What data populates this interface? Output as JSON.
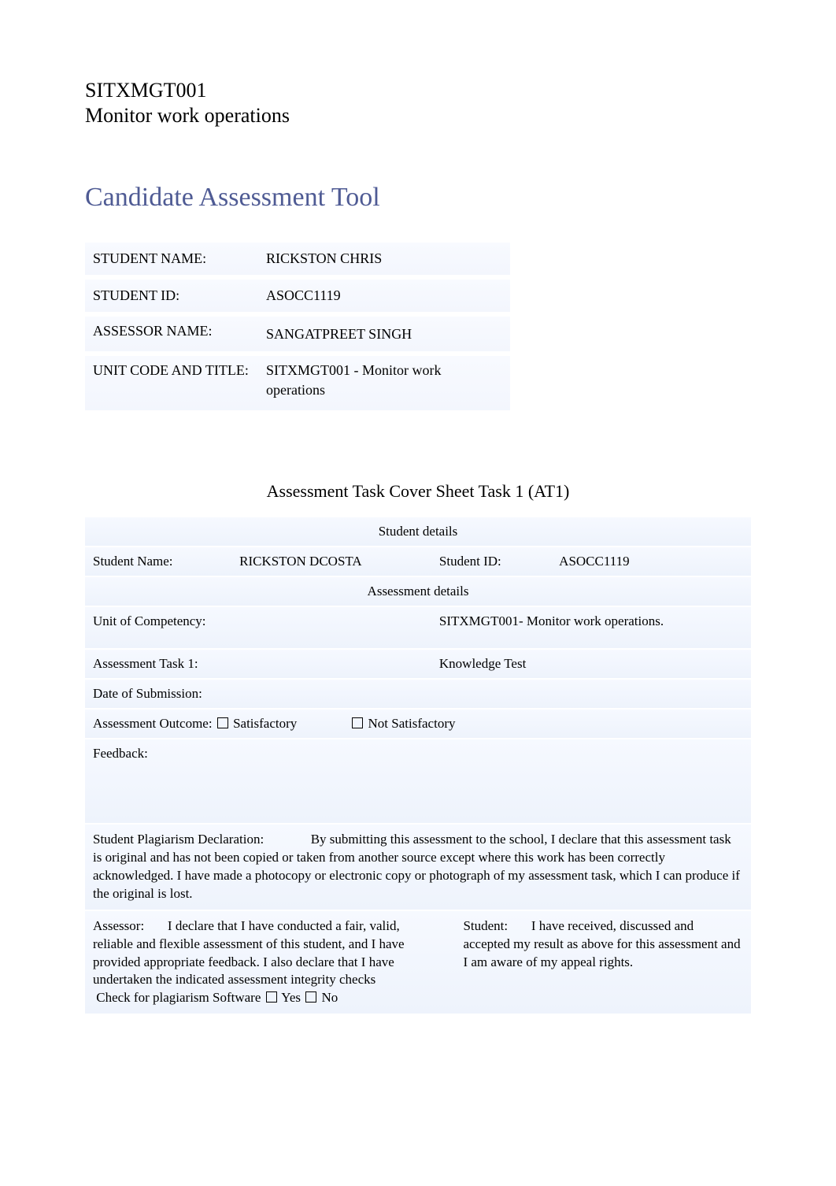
{
  "header": {
    "unit_code": "SITXMGT001",
    "unit_name": "Monitor work operations"
  },
  "main_title": "Candidate Assessment Tool",
  "info_block": {
    "student_name_label": "STUDENT NAME:",
    "student_name_value": "RICKSTON CHRIS",
    "student_id_label": "STUDENT ID:",
    "student_id_value": "ASOCC1119",
    "assessor_name_label": "ASSESSOR NAME:",
    "assessor_name_value": "SANGATPREET SINGH",
    "unit_code_title_label": "UNIT CODE AND TITLE:",
    "unit_code_title_value": " SITXMGT001 - Monitor work operations"
  },
  "cover_sheet": {
    "heading": "Assessment Task Cover Sheet Task 1 (AT1)",
    "student_details_header": "Student details",
    "student_name_label": "Student Name:",
    "student_name_value": "RICKSTON DCOSTA",
    "student_id_label": "Student ID:",
    "student_id_value": "ASOCC1119",
    "assessment_details_header": "Assessment details",
    "unit_competency_label": "Unit of Competency:",
    "unit_competency_value": "SITXMGT001- Monitor work operations.",
    "task1_label": "Assessment Task 1:",
    "task1_value": "Knowledge Test",
    "date_submission_label": "Date of Submission:",
    "date_submission_value": "",
    "outcome_label": "Assessment Outcome:",
    "outcome_satisfactory": "Satisfactory",
    "outcome_not_satisfactory": "Not Satisfactory",
    "feedback_label": "Feedback:",
    "plagiarism_label": "Student Plagiarism Declaration:",
    "plagiarism_text": "By submitting this assessment to the school, I declare that this assessment task is original and has not been copied or taken from another source except where this work has been correctly acknowledged. I have made a photocopy or electronic copy or photograph of my assessment task, which I can produce if the original is lost.",
    "assessor_decl_label": "Assessor:",
    "assessor_decl_text": "I declare that I have conducted a fair, valid, reliable and flexible assessment of this student, and I have provided appropriate feedback. I also declare that I have undertaken the indicated assessment integrity checks",
    "plag_check_label": "Check for plagiarism Software",
    "yes": "Yes",
    "no": "No",
    "student_decl_label": "Student:",
    "student_decl_text": "I have received, discussed and accepted my result as above for this assessment and I am aware of my appeal rights."
  }
}
